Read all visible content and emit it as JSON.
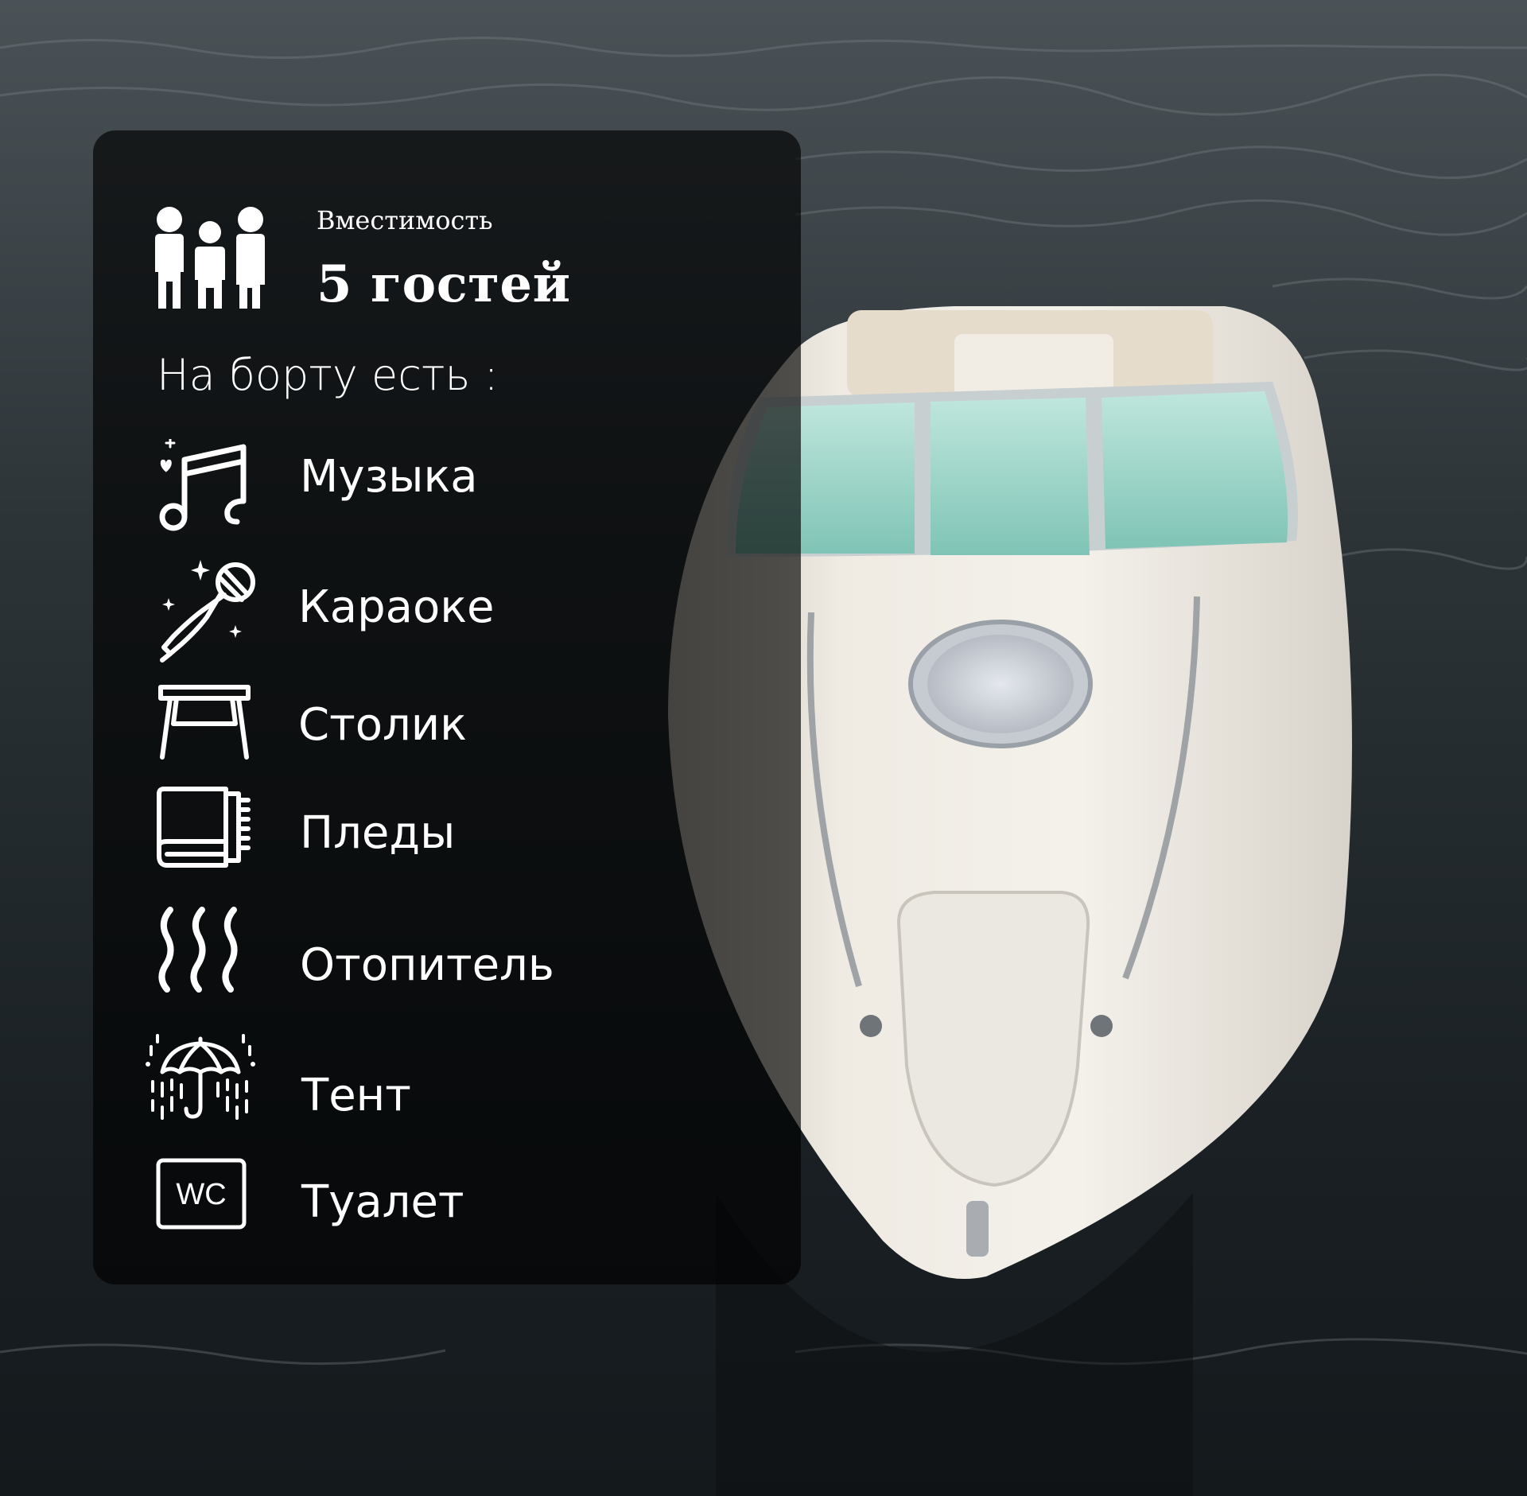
{
  "capacity": {
    "label": "Вместимость",
    "value": "5 гостей",
    "icon": "family-icon"
  },
  "onboard_title": "На борту есть :",
  "amenities": [
    {
      "label": "Музыка",
      "icon": "music-notes-icon"
    },
    {
      "label": "Караоке",
      "icon": "microphone-icon"
    },
    {
      "label": "Столик",
      "icon": "table-icon"
    },
    {
      "label": "Пледы",
      "icon": "blanket-icon"
    },
    {
      "label": "Отопитель",
      "icon": "heater-waves-icon"
    },
    {
      "label": "Тент",
      "icon": "umbrella-rain-icon"
    },
    {
      "label": "Туалет",
      "icon": "wc-icon"
    }
  ],
  "wc_sign_text": "WC",
  "colors": {
    "text": "#ffffff",
    "panel": "rgba(0,0,0,0.66)",
    "water": "#2a3338",
    "boat_hull": "#e9e4da",
    "windshield": "#8fd1c4"
  }
}
